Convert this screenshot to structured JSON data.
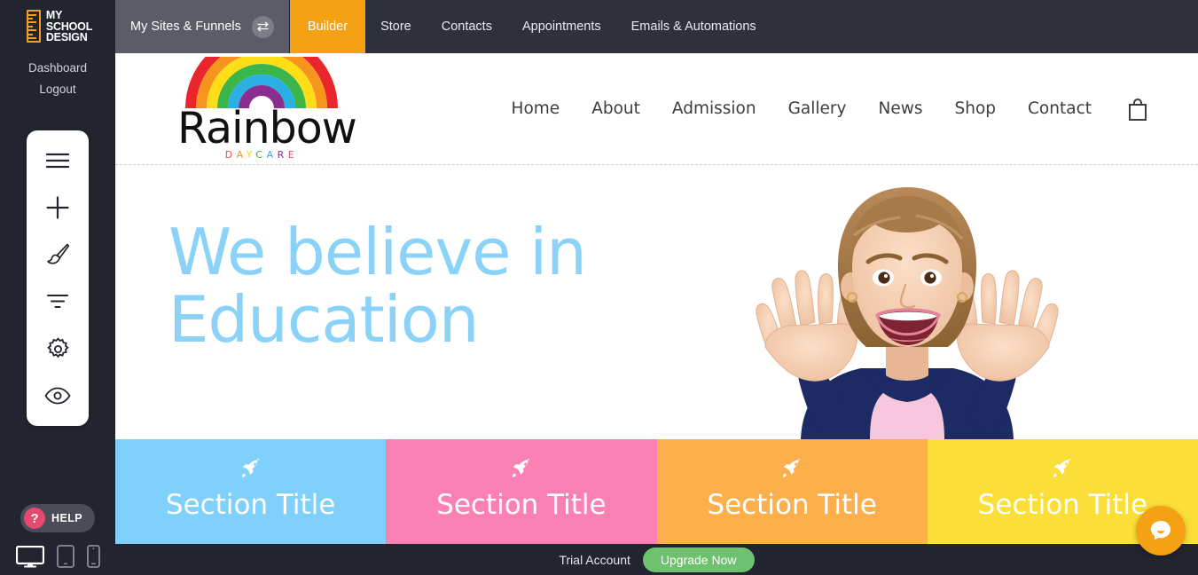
{
  "app": {
    "brand": {
      "line1": "MY",
      "line2": "SCHOOL",
      "line3": "DESIGN",
      "accent": "#f0a01e"
    },
    "sidebar_links": [
      {
        "label": "Dashboard"
      },
      {
        "label": "Logout"
      }
    ],
    "tools": [
      {
        "name": "hamburger-menu-icon"
      },
      {
        "name": "add-plus-icon"
      },
      {
        "name": "paintbrush-icon"
      },
      {
        "name": "filter-icon"
      },
      {
        "name": "gear-icon"
      },
      {
        "name": "eye-preview-icon"
      }
    ],
    "help": {
      "label": "HELP",
      "glyph": "?",
      "color": "#e8476f"
    },
    "devices": [
      {
        "name": "desktop-view",
        "active": true
      },
      {
        "name": "tablet-view",
        "active": false
      },
      {
        "name": "mobile-view",
        "active": false
      }
    ]
  },
  "topbar": {
    "sites_chip": {
      "label": "My Sites & Funnels",
      "icon": "swap-arrows-icon"
    },
    "active_tab": {
      "label": "Builder",
      "color": "#f5a114"
    },
    "tabs": [
      {
        "label": "Store"
      },
      {
        "label": "Contacts"
      },
      {
        "label": "Appointments"
      },
      {
        "label": "Emails & Automations"
      }
    ]
  },
  "site": {
    "logo": {
      "word": "Rainbow",
      "tagline": "DAYCARE",
      "rainbow_colors": [
        "#e8262c",
        "#f7941e",
        "#ffdd17",
        "#3bb54a",
        "#2ab0e4",
        "#8a2f8f"
      ],
      "tagline_colors": [
        "#f04e4e",
        "#f7941e",
        "#ffd200",
        "#3bb54a",
        "#2ab0e4",
        "#8a2f8f",
        "#e8508f"
      ]
    },
    "nav": [
      {
        "label": "Home"
      },
      {
        "label": "About"
      },
      {
        "label": "Admission"
      },
      {
        "label": "Gallery"
      },
      {
        "label": "News"
      },
      {
        "label": "Shop"
      },
      {
        "label": "Contact"
      }
    ],
    "cart_icon": "shopping-bag-icon",
    "hero": {
      "title": "We believe in\nEducation",
      "title_color": "#8ad2f8",
      "image_alt": "smiling-girl-hands-up"
    },
    "tiles": [
      {
        "title": "Section Title",
        "color": "#7fd1fb",
        "icon": "rocket-icon"
      },
      {
        "title": "Section Title",
        "color": "#fb81b5",
        "icon": "rocket-icon"
      },
      {
        "title": "Section Title",
        "color": "#fcaf4a",
        "icon": "rocket-icon"
      },
      {
        "title": "Section Title",
        "color": "#fbdf38",
        "icon": "rocket-icon"
      }
    ]
  },
  "bottombar": {
    "trial_label": "Trial Account",
    "upgrade_label": "Upgrade Now",
    "upgrade_color": "#6ec16e"
  },
  "chat": {
    "icon": "chat-bubble-icon",
    "color": "#f5a114"
  }
}
